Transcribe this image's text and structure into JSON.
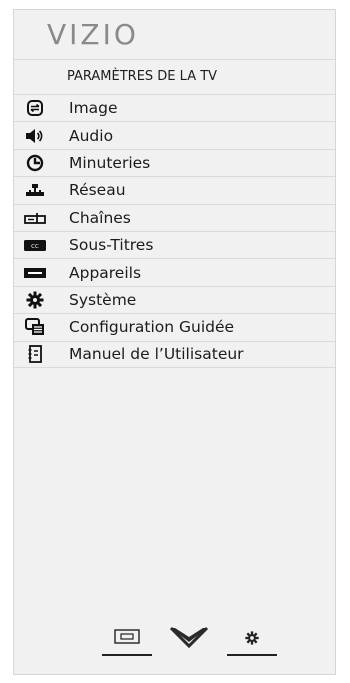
{
  "brand": {
    "logo_text": "VIZIO"
  },
  "menu": {
    "title": "PARAMÈTRES DE LA TV",
    "items": [
      {
        "label": "Image",
        "icon": "picture-icon"
      },
      {
        "label": "Audio",
        "icon": "speaker-icon"
      },
      {
        "label": "Minuteries",
        "icon": "clock-icon"
      },
      {
        "label": "Réseau",
        "icon": "network-icon"
      },
      {
        "label": "Chaînes",
        "icon": "antenna-icon"
      },
      {
        "label": "Sous-Titres",
        "icon": "closed-caption-icon"
      },
      {
        "label": "Appareils",
        "icon": "devices-icon"
      },
      {
        "label": "Système",
        "icon": "gear-icon"
      },
      {
        "label": "Configuration Guidée",
        "icon": "guided-setup-icon"
      },
      {
        "label": "Manuel de l’Utilisateur",
        "icon": "manual-icon"
      }
    ]
  },
  "footer": {
    "buttons": [
      {
        "name": "picture-mode-button",
        "icon": "screen-icon"
      },
      {
        "name": "menu-close-button",
        "icon": "chevron-down-icon"
      },
      {
        "name": "settings-button",
        "icon": "gear-icon"
      }
    ]
  },
  "colors": {
    "panel_bg": "#f1f1f1",
    "text": "#1c1c1c",
    "logo": "#8a8a8a"
  }
}
